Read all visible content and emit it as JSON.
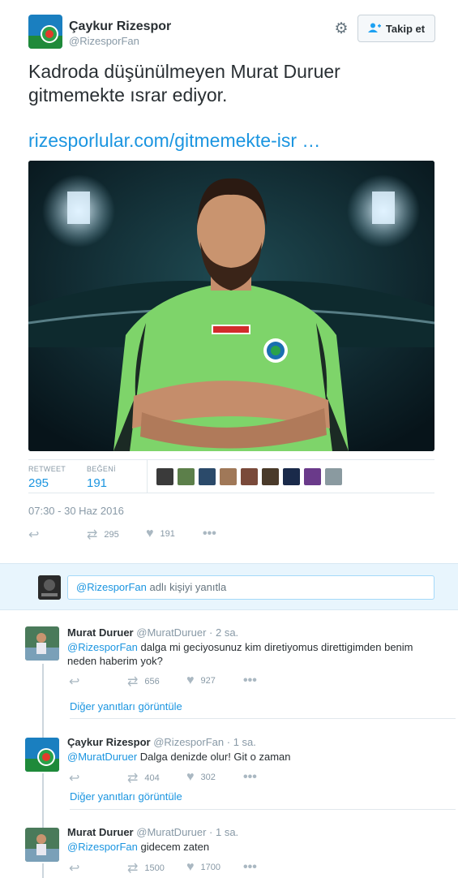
{
  "account": {
    "name": "Çaykur Rizespor",
    "handle": "@RizesporFan"
  },
  "follow_button": {
    "label": "Takip et",
    "icon": "add-user-icon"
  },
  "settings_icon": "gear-icon",
  "tweet": {
    "text": "Kadroda düşünülmeyen Murat Duruer gitmemekte ısrar ediyor.",
    "link": "rizesporlular.com/gitmemekte-isr …",
    "retweet_label": "RETWEET",
    "retweet_count": "295",
    "like_label": "BEĞENİ",
    "like_count": "191",
    "timestamp": "07:30 - 30 Haz 2016",
    "actions": {
      "retweet": "295",
      "like": "191"
    }
  },
  "reply_box": {
    "mention": "@RizesporFan",
    "rest": " adlı kişiyi yanıtla"
  },
  "replies": [
    {
      "name": "Murat Duruer",
      "handle": "@MuratDuruer",
      "time": "· 2 sa.",
      "mention": "@RizesporFan",
      "text": " dalga mi geciyosunuz kim diretiyomus direttigimden benim neden haberim yok?",
      "retweets": "656",
      "likes": "927",
      "more": "Diğer yanıtları görüntüle"
    },
    {
      "name": "Çaykur Rizespor",
      "handle": "@RizesporFan",
      "time": "· 1 sa.",
      "mention": "@MuratDuruer",
      "text": " Dalga denizde olur! Git o zaman",
      "retweets": "404",
      "likes": "302",
      "more": "Diğer yanıtları görüntüle"
    },
    {
      "name": "Murat Duruer",
      "handle": "@MuratDuruer",
      "time": "· 1 sa.",
      "mention": "@RizesporFan",
      "text": " gidecem zaten",
      "retweets": "1500",
      "likes": "1700"
    }
  ],
  "colors": {
    "link": "#1b95e0",
    "muted": "#8899a6",
    "jersey": "#7ed46a"
  }
}
